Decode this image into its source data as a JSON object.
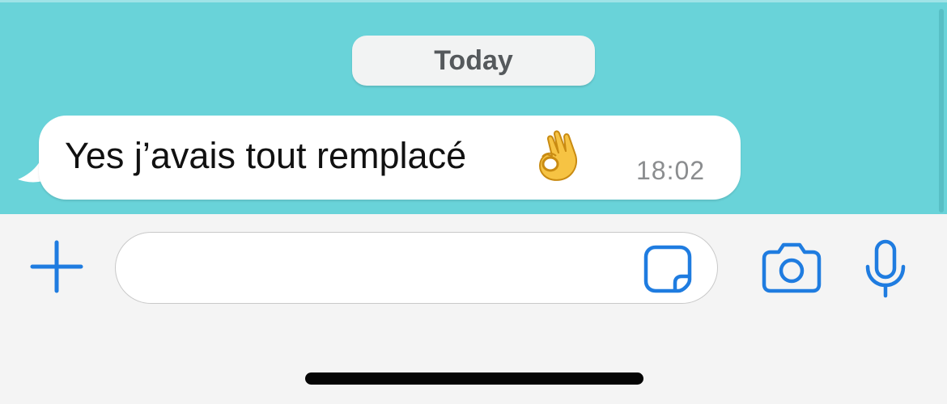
{
  "chat": {
    "date_separator": "Today",
    "messages": [
      {
        "text": "Yes j’avais tout remplacé",
        "emoji_icon": "ok-hand-emoji",
        "time": "18:02"
      }
    ]
  },
  "input_bar": {
    "placeholder": "",
    "value": "",
    "icons": {
      "add": "plus-icon",
      "sticker": "sticker-icon",
      "camera": "camera-icon",
      "microphone": "microphone-icon"
    }
  },
  "colors": {
    "chat_background": "#69d3d9",
    "bubble_background": "#ffffff",
    "accent": "#1f7ce0",
    "input_bar_background": "#f4f4f4",
    "timestamp": "#8b8d8f"
  }
}
